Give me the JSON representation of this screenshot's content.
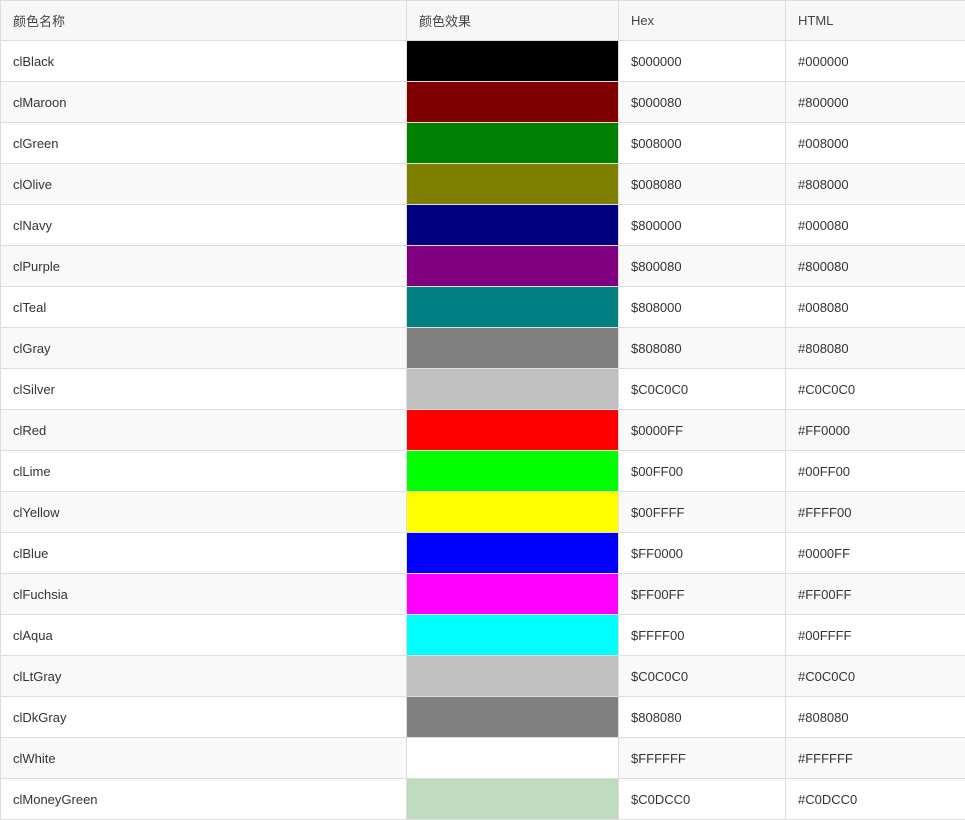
{
  "headers": {
    "name": "颜色名称",
    "swatch": "颜色效果",
    "hex": "Hex",
    "html": "HTML"
  },
  "rows": [
    {
      "name": "clBlack",
      "swatch": "#000000",
      "hex": "$000000",
      "html": "#000000"
    },
    {
      "name": "clMaroon",
      "swatch": "#800000",
      "hex": "$000080",
      "html": "#800000"
    },
    {
      "name": "clGreen",
      "swatch": "#008000",
      "hex": "$008000",
      "html": "#008000"
    },
    {
      "name": "clOlive",
      "swatch": "#808000",
      "hex": "$008080",
      "html": "#808000"
    },
    {
      "name": "clNavy",
      "swatch": "#000080",
      "hex": "$800000",
      "html": "#000080"
    },
    {
      "name": "clPurple",
      "swatch": "#800080",
      "hex": "$800080",
      "html": "#800080"
    },
    {
      "name": "clTeal",
      "swatch": "#008080",
      "hex": "$808000",
      "html": "#008080"
    },
    {
      "name": "clGray",
      "swatch": "#808080",
      "hex": "$808080",
      "html": "#808080"
    },
    {
      "name": "clSilver",
      "swatch": "#C0C0C0",
      "hex": "$C0C0C0",
      "html": "#C0C0C0"
    },
    {
      "name": "clRed",
      "swatch": "#FF0000",
      "hex": "$0000FF",
      "html": "#FF0000"
    },
    {
      "name": "clLime",
      "swatch": "#00FF00",
      "hex": "$00FF00",
      "html": "#00FF00"
    },
    {
      "name": "clYellow",
      "swatch": "#FFFF00",
      "hex": "$00FFFF",
      "html": "#FFFF00"
    },
    {
      "name": "clBlue",
      "swatch": "#0000FF",
      "hex": "$FF0000",
      "html": "#0000FF"
    },
    {
      "name": "clFuchsia",
      "swatch": "#FF00FF",
      "hex": "$FF00FF",
      "html": "#FF00FF"
    },
    {
      "name": "clAqua",
      "swatch": "#00FFFF",
      "hex": "$FFFF00",
      "html": "#00FFFF"
    },
    {
      "name": "clLtGray",
      "swatch": "#C0C0C0",
      "hex": "$C0C0C0",
      "html": "#C0C0C0"
    },
    {
      "name": "clDkGray",
      "swatch": "#808080",
      "hex": "$808080",
      "html": "#808080"
    },
    {
      "name": "clWhite",
      "swatch": "#FFFFFF",
      "hex": "$FFFFFF",
      "html": "#FFFFFF"
    },
    {
      "name": "clMoneyGreen",
      "swatch": "#C0DCC0",
      "hex": "$C0DCC0",
      "html": "#C0DCC0"
    }
  ]
}
